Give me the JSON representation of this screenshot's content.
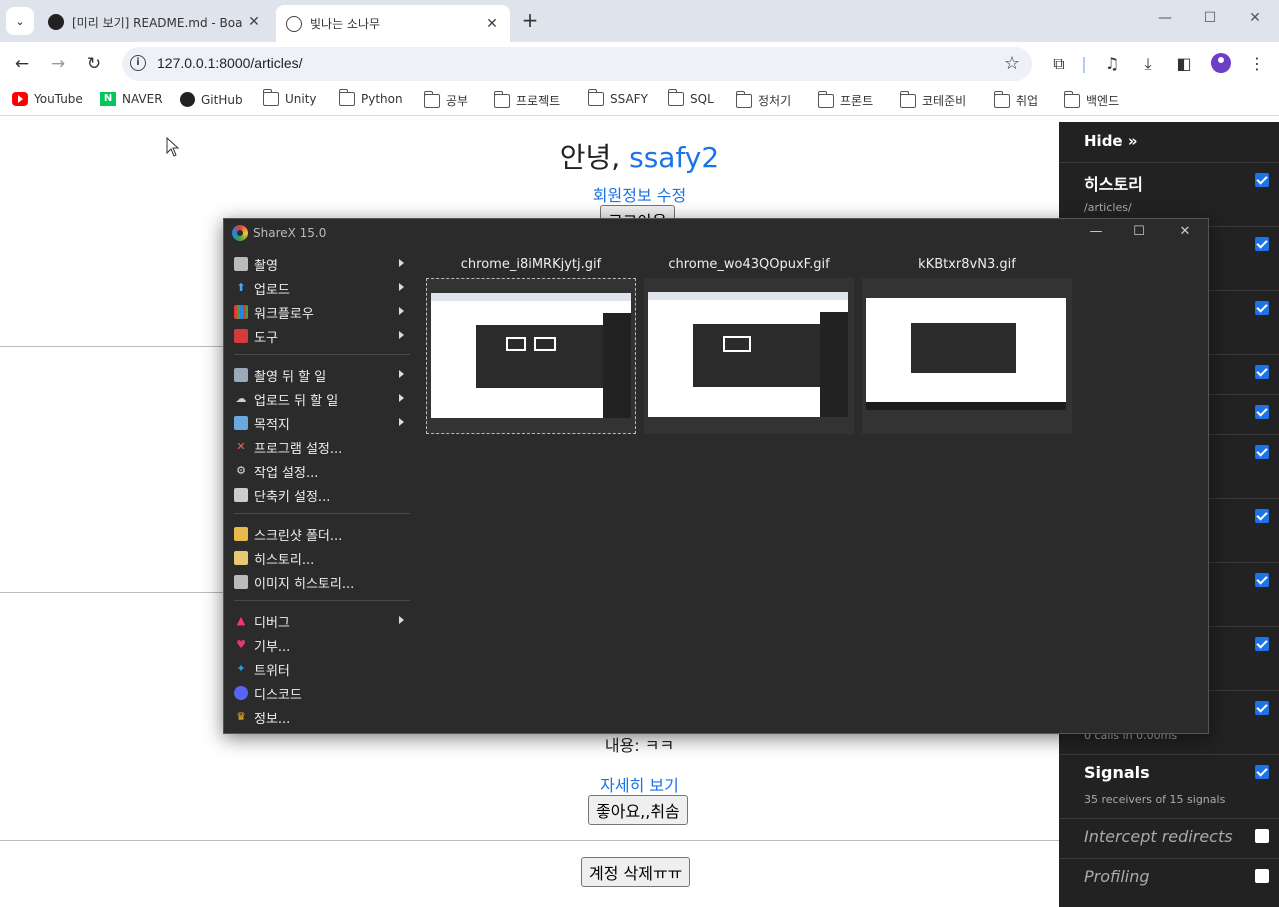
{
  "browser": {
    "tabs": [
      {
        "title": "[미리 보기] README.md - Boa",
        "active": false,
        "icon": "github-icon"
      },
      {
        "title": "빛나는 소나무",
        "active": true,
        "icon": "globe-icon"
      }
    ],
    "url": "127.0.0.1:8000/articles/",
    "bookmarks": [
      "YouTube",
      "NAVER",
      "GitHub",
      "Unity",
      "Python",
      "공부",
      "프로젝트",
      "SSAFY",
      "SQL",
      "정처기",
      "프론트",
      "코테준비",
      "취업",
      "백엔드"
    ]
  },
  "page": {
    "greeting_prefix": "안녕,",
    "username": "ssafy2",
    "profile_edit": "회원정보 수정",
    "logout": "로그아웃",
    "content": "내용: ㅋㅋ",
    "detail_link": "자세히 보기",
    "like_button": "좋아요,,취솜",
    "delete_account": "계정 삭제ㅠㅠ"
  },
  "debug_toolbar": {
    "hide": "Hide »",
    "panels": [
      {
        "title": "히스토리",
        "sub": "/articles/",
        "checked": true
      },
      {
        "title": "",
        "sub": "",
        "checked": true
      },
      {
        "title": "",
        "sub": "",
        "checked": true
      },
      {
        "title": "",
        "sub": "",
        "checked": true
      },
      {
        "title": "",
        "sub": "",
        "checked": true
      },
      {
        "title": "",
        "sub": "",
        "checked": true
      },
      {
        "title": "",
        "sub": "",
        "checked": true
      },
      {
        "title": "",
        "sub": "",
        "checked": true
      },
      {
        "title": "",
        "sub": "",
        "checked": true
      },
      {
        "title": "",
        "sub": "0 calls in 0.00ms",
        "checked": true
      },
      {
        "title": "Signals",
        "sub": "35 receivers of 15 signals",
        "checked": true
      },
      {
        "title": "Intercept redirects",
        "sub": "",
        "checked": false
      },
      {
        "title": "Profiling",
        "sub": "",
        "checked": false
      }
    ]
  },
  "sharex": {
    "title": "ShareX 15.0",
    "menu": [
      {
        "label": "촬영",
        "submenu": true,
        "icon": "capture-icon"
      },
      {
        "label": "업로드",
        "submenu": true,
        "icon": "upload-icon"
      },
      {
        "label": "워크플로우",
        "submenu": true,
        "icon": "workflow-icon"
      },
      {
        "label": "도구",
        "submenu": true,
        "icon": "tools-icon"
      },
      {
        "label": "촬영 뒤 할 일",
        "submenu": true,
        "icon": "after-capture-icon"
      },
      {
        "label": "업로드 뒤 할 일",
        "submenu": true,
        "icon": "after-upload-icon"
      },
      {
        "label": "목적지",
        "submenu": true,
        "icon": "destinations-icon"
      },
      {
        "label": "프로그램 설정...",
        "submenu": false,
        "icon": "app-settings-icon"
      },
      {
        "label": "작업 설정...",
        "submenu": false,
        "icon": "task-settings-icon"
      },
      {
        "label": "단축키 설정...",
        "submenu": false,
        "icon": "hotkey-settings-icon"
      },
      {
        "label": "스크린샷 폴더...",
        "submenu": false,
        "icon": "screenshot-folder-icon"
      },
      {
        "label": "히스토리...",
        "submenu": false,
        "icon": "history-icon"
      },
      {
        "label": "이미지 히스토리...",
        "submenu": false,
        "icon": "image-history-icon"
      },
      {
        "label": "디버그",
        "submenu": true,
        "icon": "debug-icon"
      },
      {
        "label": "기부...",
        "submenu": false,
        "icon": "heart-icon"
      },
      {
        "label": "트위터",
        "submenu": false,
        "icon": "twitter-icon"
      },
      {
        "label": "디스코드",
        "submenu": false,
        "icon": "discord-icon"
      },
      {
        "label": "정보...",
        "submenu": false,
        "icon": "crown-icon"
      }
    ],
    "files": [
      "chrome_i8iMRKjytj.gif",
      "chrome_wo43QOpuxF.gif",
      "kKBtxr8vN3.gif"
    ]
  }
}
